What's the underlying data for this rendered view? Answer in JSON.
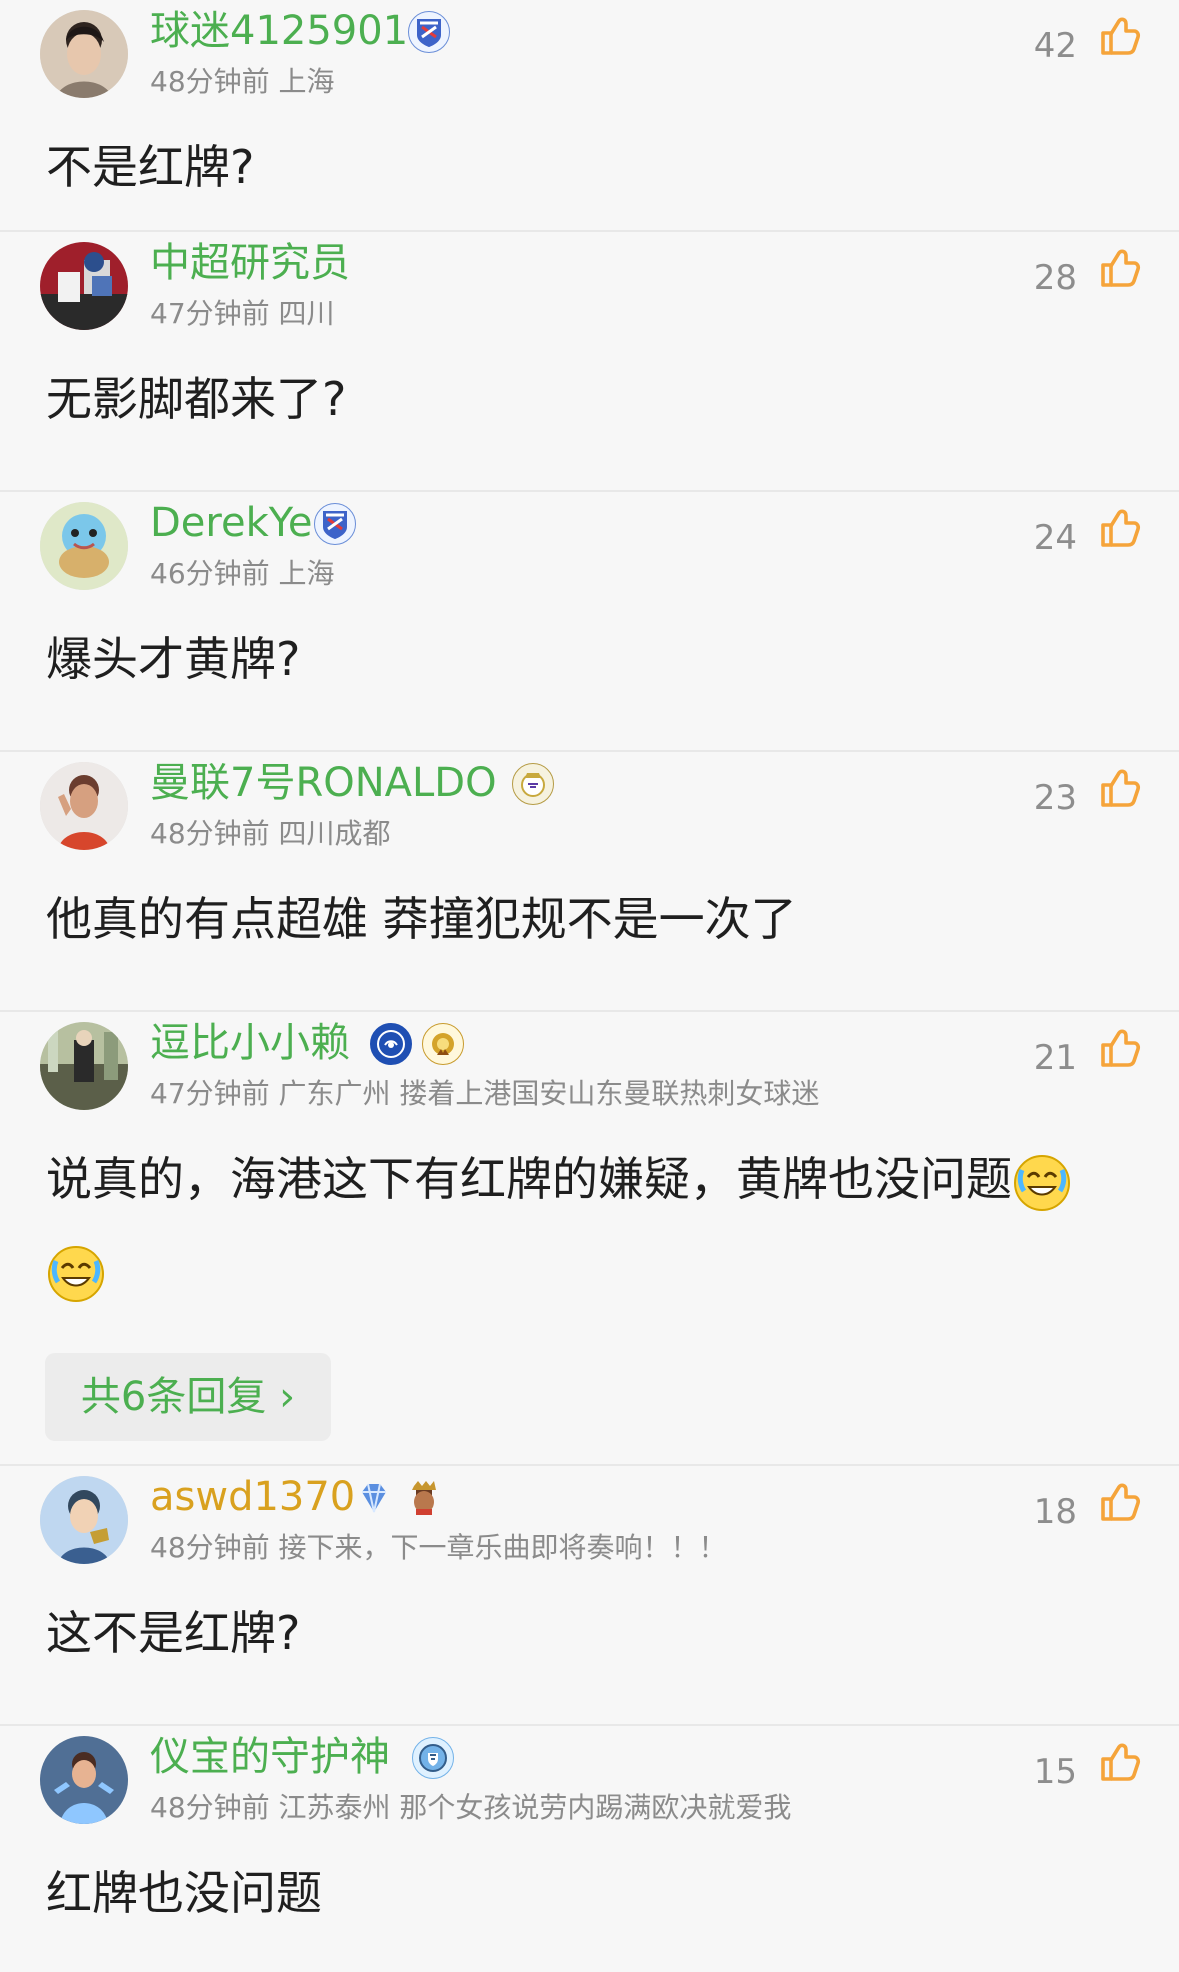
{
  "comments": [
    {
      "username": "球迷4125901",
      "meta": "48分钟前 上海",
      "likes": "42",
      "text": "不是红牌?",
      "badges": [
        "shenhua-badge"
      ]
    },
    {
      "username": "中超研究员",
      "meta": "47分钟前 四川",
      "likes": "28",
      "text": "无影脚都来了?",
      "badges": []
    },
    {
      "username": "DerekYe",
      "meta": "46分钟前 上海",
      "likes": "24",
      "text": "爆头才黄牌?",
      "badges": [
        "shenhua-badge"
      ]
    },
    {
      "username": "曼联7号RONALDO",
      "meta": "48分钟前 四川成都",
      "likes": "23",
      "text": "他真的有点超雄 莽撞犯规不是一次了",
      "badges": [
        "real-madrid-badge"
      ]
    },
    {
      "username": "逗比小小赖",
      "meta": "47分钟前 广东广州 搂着上港国安山东曼联热刺女球迷",
      "likes": "21",
      "text": "说真的，海港这下有红牌的嫌疑，黄牌也没问题",
      "badges": [
        "chelsea-badge",
        "gold-medal-badge"
      ],
      "replies_label": "共6条回复"
    },
    {
      "username": "aswd1370",
      "meta": "48分钟前 接下来，下一章乐曲即将奏响！！！",
      "likes": "18",
      "text": "这不是红牌?",
      "badges": [
        "diamond-badge",
        "player-badge"
      ]
    },
    {
      "username": "仪宝的守护神",
      "meta": "48分钟前 江苏泰州 那个女孩说劳内踢满欧决就爱我",
      "likes": "15",
      "text": "红牌也没问题",
      "badges": [
        "man-city-badge"
      ]
    }
  ],
  "colors": {
    "username": "#4caf50",
    "meta": "#8b8b8b",
    "like_icon": "#f5a43a",
    "text": "#1f1f1f",
    "background": "#f7f7f7"
  }
}
